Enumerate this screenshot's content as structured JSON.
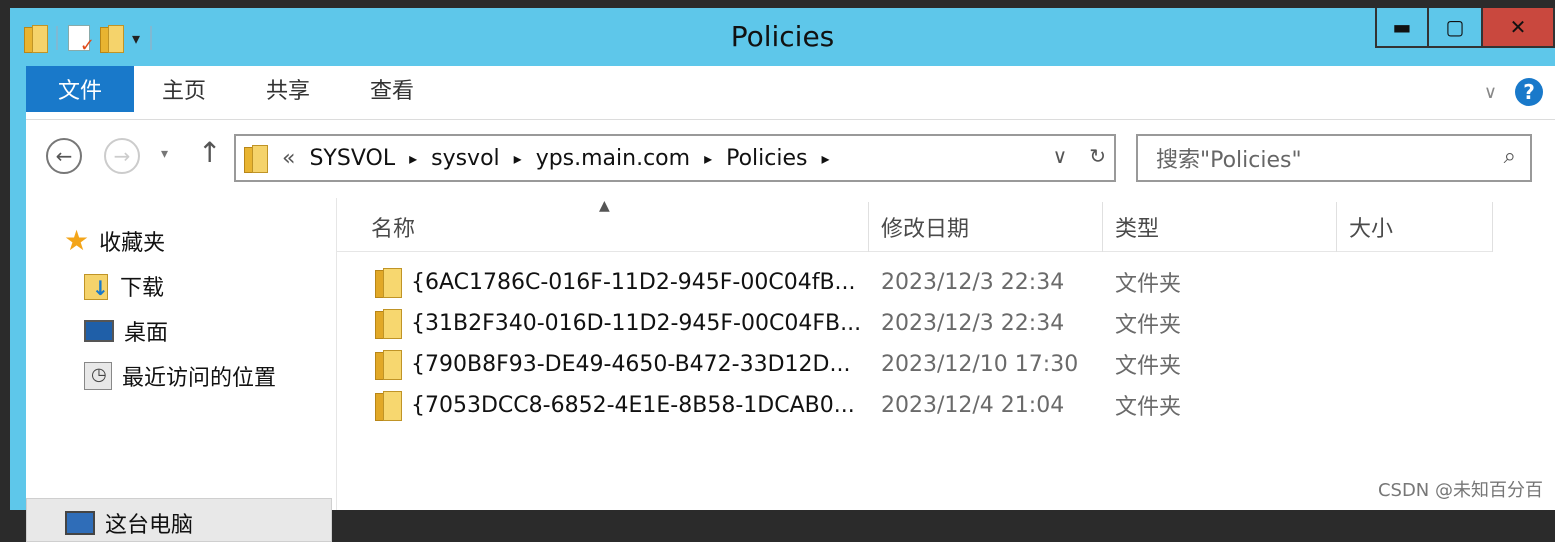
{
  "window": {
    "title": "Policies",
    "quick_access_dropdown": "▾",
    "controls": {
      "minimize": "▬",
      "maximize": "▢",
      "close": "✕"
    }
  },
  "ribbon": {
    "tabs": [
      "文件",
      "主页",
      "共享",
      "查看"
    ],
    "expand": "∨",
    "help": "?"
  },
  "nav": {
    "back": "←",
    "forward": "→",
    "recent_dropdown": "▾",
    "up": "↑"
  },
  "address": {
    "overflow": "«",
    "crumbs": [
      "SYSVOL",
      "sysvol",
      "yps.main.com",
      "Policies"
    ],
    "separator": "▸",
    "dropdown": "∨",
    "refresh": "↻"
  },
  "search": {
    "placeholder": "搜索\"Policies\"",
    "icon": "search-icon"
  },
  "navpane": {
    "favorites": "收藏夹",
    "downloads": "下载",
    "desktop": "桌面",
    "recent": "最近访问的位置",
    "this_pc": "这台电脑"
  },
  "columns": {
    "name": "名称",
    "modified": "修改日期",
    "type": "类型",
    "size": "大小"
  },
  "files": [
    {
      "name": "{6AC1786C-016F-11D2-945F-00C04fB...",
      "modified": "2023/12/3 22:34",
      "type": "文件夹"
    },
    {
      "name": "{31B2F340-016D-11D2-945F-00C04FB...",
      "modified": "2023/12/3 22:34",
      "type": "文件夹"
    },
    {
      "name": "{790B8F93-DE49-4650-B472-33D12D...",
      "modified": "2023/12/10 17:30",
      "type": "文件夹"
    },
    {
      "name": "{7053DCC8-6852-4E1E-8B58-1DCAB0...",
      "modified": "2023/12/4 21:04",
      "type": "文件夹"
    }
  ],
  "watermark": "CSDN @未知百分百",
  "colors": {
    "titlebar": "#5ec7ea",
    "file_tab": "#1979ca",
    "close_button": "#c9483e",
    "folder": "#f5d36b"
  }
}
